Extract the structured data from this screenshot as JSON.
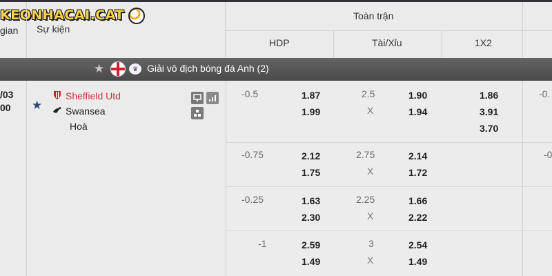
{
  "brand": {
    "logo_text": "KEONHACAI.CAT"
  },
  "header": {
    "col_time": "gian",
    "col_event": "Sự kiện",
    "group": "Toàn trận",
    "hdp": "HDP",
    "ou": "Tài/Xỉu",
    "x12": "1X2"
  },
  "league": {
    "name": "Giải vô địch bóng đá Anh (2)",
    "star_icon": "star-icon",
    "flag_icon": "england-flag-icon",
    "logo_icon": "premier-league-logo-icon"
  },
  "match": {
    "time_line1": "/03",
    "time_line2": "00",
    "home": "Sheffield Utd",
    "away": "Swansea",
    "draw": "Hoà",
    "home_color": "#d0303c"
  },
  "rows": [
    {
      "hdp": "-0.5",
      "hdp_home": "1.87",
      "hdp_away": "1.99",
      "ou": "2.5",
      "ou_x": "X",
      "ou_over": "1.90",
      "ou_under": "1.94",
      "x12_1": "1.86",
      "x12_2": "3.91",
      "x12_x": "3.70",
      "right": "-0."
    },
    {
      "hdp": "-0.75",
      "hdp_home": "2.12",
      "hdp_away": "1.75",
      "ou": "2.75",
      "ou_x": "X",
      "ou_over": "2.14",
      "ou_under": "1.72",
      "right": "-0"
    },
    {
      "hdp": "-0.25",
      "hdp_home": "1.63",
      "hdp_away": "2.30",
      "ou": "2.25",
      "ou_x": "X",
      "ou_over": "1.66",
      "ou_under": "2.22",
      "right": ""
    },
    {
      "hdp": "-1",
      "hdp_home": "2.59",
      "hdp_away": "1.49",
      "ou": "3",
      "ou_x": "X",
      "ou_over": "2.54",
      "ou_under": "1.49",
      "right": ""
    }
  ],
  "colors": {
    "league_bar": "#555555",
    "fav_star": "#2b4c72",
    "topline": "#2f3136"
  }
}
